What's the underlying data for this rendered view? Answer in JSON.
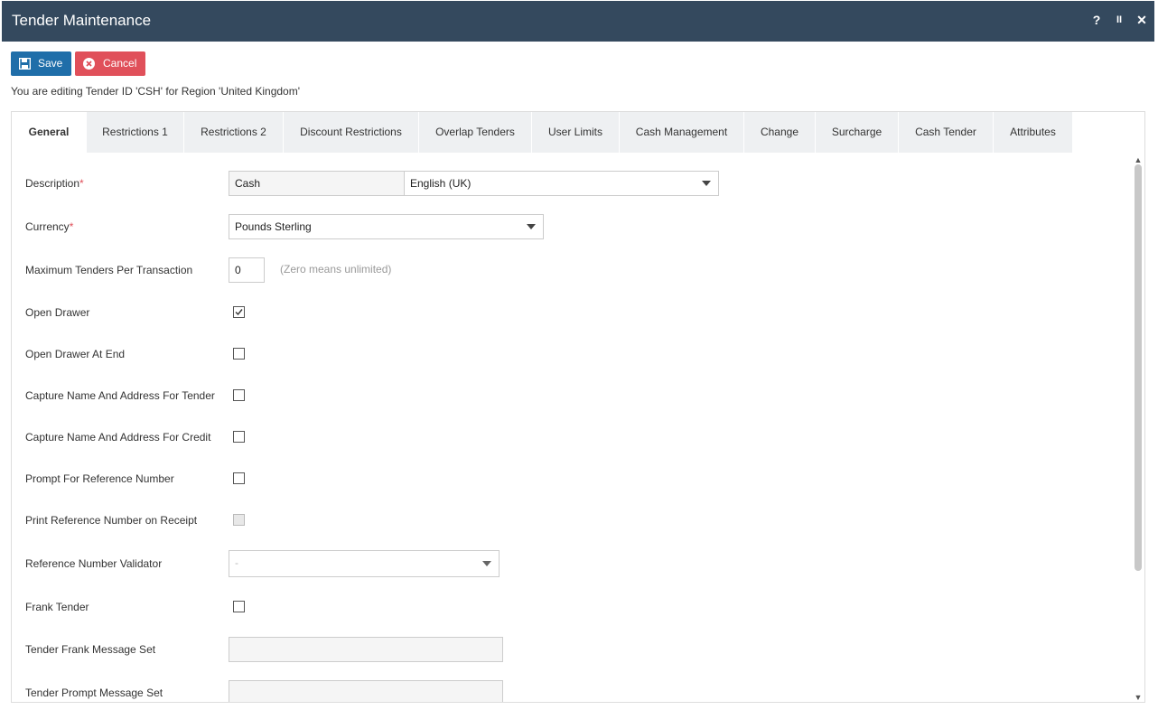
{
  "window": {
    "title": "Tender Maintenance",
    "help": "?",
    "pause": "II",
    "close": "✕"
  },
  "toolbar": {
    "save_label": "Save",
    "cancel_label": "Cancel"
  },
  "editing_text": "You are editing Tender ID 'CSH' for Region 'United Kingdom'",
  "tabs": [
    {
      "label": "General",
      "active": true
    },
    {
      "label": "Restrictions 1"
    },
    {
      "label": "Restrictions 2"
    },
    {
      "label": "Discount Restrictions"
    },
    {
      "label": "Overlap Tenders"
    },
    {
      "label": "User Limits"
    },
    {
      "label": "Cash Management"
    },
    {
      "label": "Change"
    },
    {
      "label": "Surcharge"
    },
    {
      "label": "Cash Tender"
    },
    {
      "label": "Attributes"
    }
  ],
  "form": {
    "description": {
      "label": "Description",
      "required": "*",
      "value": "Cash",
      "language": "English (UK)"
    },
    "currency": {
      "label": "Currency",
      "required": "*",
      "value": "Pounds Sterling"
    },
    "max_tenders": {
      "label": "Maximum Tenders Per Transaction",
      "value": "0",
      "hint": "(Zero means unlimited)"
    },
    "open_drawer": {
      "label": "Open Drawer",
      "checked": true
    },
    "open_drawer_end": {
      "label": "Open Drawer At End",
      "checked": false
    },
    "capture_tender": {
      "label": "Capture Name And Address For Tender",
      "checked": false
    },
    "capture_credit": {
      "label": "Capture Name And Address For Credit",
      "checked": false
    },
    "prompt_ref": {
      "label": "Prompt For Reference Number",
      "checked": false
    },
    "print_ref": {
      "label": "Print Reference Number on Receipt",
      "checked": false,
      "disabled": true
    },
    "ref_validator": {
      "label": "Reference Number Validator",
      "value": "-"
    },
    "frank_tender": {
      "label": "Frank Tender",
      "checked": false
    },
    "frank_msg": {
      "label": "Tender Frank Message Set",
      "value": ""
    },
    "prompt_msg": {
      "label": "Tender Prompt Message Set",
      "value": ""
    }
  },
  "colors": {
    "titlebar": "#34495e",
    "save": "#1f6ea9",
    "cancel": "#e0505a"
  }
}
